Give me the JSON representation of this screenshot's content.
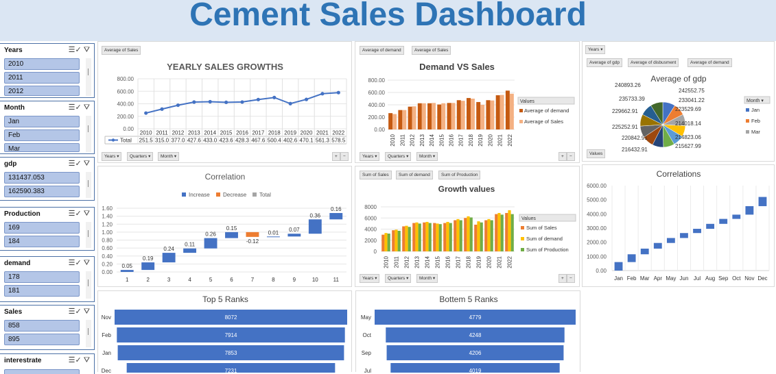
{
  "dashboard_title": "Cement Sales Dashboard",
  "slicers": [
    {
      "title": "Years",
      "items": [
        "2010",
        "2011",
        "2012"
      ]
    },
    {
      "title": "Month",
      "items": [
        "Jan",
        "Feb",
        "Mar"
      ]
    },
    {
      "title": "gdp",
      "items": [
        "131437.053",
        "162590.383"
      ]
    },
    {
      "title": "Production",
      "items": [
        "169",
        "184"
      ]
    },
    {
      "title": "demand",
      "items": [
        "178",
        "181"
      ]
    },
    {
      "title": "Sales",
      "items": [
        "858",
        "895"
      ]
    },
    {
      "title": "interestrate",
      "items": []
    }
  ],
  "yearly": {
    "field_button": "Average of Sales",
    "filter_buttons": [
      "Years ▾",
      "Quarters ▾",
      "Month ▾"
    ],
    "legend_label": "Total",
    "chart_data": {
      "type": "line",
      "title": "YEARLY SALES GROWTHS",
      "categories": [
        "2010",
        "2011",
        "2012",
        "2013",
        "2014",
        "2015",
        "2016",
        "2017",
        "2018",
        "2019",
        "2020",
        "2021",
        "2022"
      ],
      "values": [
        251.5,
        315.0,
        377.0,
        427.6,
        433.0,
        423.6,
        428.3,
        467.6,
        500.4,
        402.6,
        470.1,
        561.3,
        578.5
      ],
      "value_labels": [
        "251.5",
        "315.0",
        "377.0",
        "427.6",
        "433.0",
        "423.6",
        "428.3",
        "467.6",
        "500.4",
        "402.6",
        "470.1",
        "561.3",
        "578.5"
      ],
      "ylim": [
        0,
        800
      ],
      "yticks": [
        "0.00",
        "200.00",
        "400.00",
        "600.00",
        "800.00"
      ]
    }
  },
  "demand_sales": {
    "field_buttons": [
      "Average of demand",
      "Average of Sales"
    ],
    "filter_buttons": [
      "Years ▾",
      "Quarters ▾",
      "Month ▾"
    ],
    "legend_title": "Values",
    "colors": {
      "demand": "#c55a11",
      "sales": "#f4b183"
    },
    "chart_data": {
      "type": "bar",
      "title": "Demand VS Sales",
      "categories": [
        "2010",
        "2011",
        "2012",
        "2013",
        "2014",
        "2015",
        "2016",
        "2017",
        "2018",
        "2019",
        "2020",
        "2021",
        "2022"
      ],
      "series": [
        {
          "name": "Average of demand",
          "values": [
            265,
            315,
            370,
            425,
            425,
            405,
            430,
            475,
            510,
            445,
            475,
            555,
            630
          ]
        },
        {
          "name": "Average of Sales",
          "values": [
            250,
            315,
            375,
            425,
            430,
            425,
            430,
            465,
            500,
            400,
            470,
            560,
            580
          ]
        }
      ],
      "ylim": [
        0,
        800
      ],
      "yticks": [
        "0.00",
        "200.00",
        "400.00",
        "600.00",
        "800.00"
      ]
    }
  },
  "gdp": {
    "field_buttons": [
      "Average of gdp",
      "Average of disbusment",
      "Average of demand"
    ],
    "top_button": "Years ▾",
    "values_button": "Values",
    "legend_title": "Month ▾",
    "legend": [
      "Jan",
      "Feb",
      "Mar"
    ],
    "colors": [
      "#4472c4",
      "#ed7d31",
      "#a5a5a5"
    ],
    "chart_data": {
      "type": "pie",
      "title": "Average of gdp",
      "labels": [
        "242552.75",
        "233041.22",
        "223529.69",
        "214018.14",
        "214823.06",
        "215627.99",
        "216432.91",
        "220842.91",
        "225252.91",
        "229662.91",
        "235733.39",
        "240893.26"
      ],
      "values": [
        242552.75,
        233041.22,
        223529.69,
        214018.14,
        214823.06,
        215627.99,
        216432.91,
        220842.91,
        225252.91,
        229662.91,
        235733.39,
        240893.26
      ]
    }
  },
  "correlation": {
    "colors": {
      "increase": "#4472c4",
      "decrease": "#ed7d31",
      "total": "#a5a5a5"
    },
    "chart_data": {
      "type": "bar",
      "title": "Correlation",
      "legend": [
        "Increase",
        "Decrease",
        "Total"
      ],
      "categories": [
        "1",
        "2",
        "3",
        "4",
        "5",
        "6",
        "7",
        "8",
        "9",
        "10",
        "11"
      ],
      "deltas": [
        0.05,
        0.19,
        0.24,
        0.11,
        0.26,
        0.15,
        -0.12,
        0.01,
        0.07,
        0.36,
        0.16
      ],
      "value_labels": [
        "0.05",
        "0.19",
        "0.24",
        "0.11",
        "0.26",
        "0.15",
        "-0.12",
        "0.01",
        "0.07",
        "0.36",
        "0.16"
      ],
      "ylim": [
        0,
        1.6
      ],
      "yticks": [
        "0.00",
        "0.20",
        "0.40",
        "0.60",
        "0.80",
        "1.00",
        "1.20",
        "1.40",
        "1.60"
      ]
    }
  },
  "growth": {
    "field_buttons": [
      "Sum of Sales",
      "Sum of demand",
      "Sum of Production"
    ],
    "filter_buttons": [
      "Years ▾",
      "Quarters ▾",
      "Month ▾"
    ],
    "legend_title": "Values",
    "colors": {
      "sales": "#ed7d31",
      "demand": "#ffc000",
      "production": "#70ad47"
    },
    "chart_data": {
      "type": "bar",
      "title": "Growth values",
      "categories": [
        "2010",
        "2011",
        "2012",
        "2013",
        "2014",
        "2015",
        "2016",
        "2017",
        "2018",
        "2019",
        "2020",
        "2021",
        "2022"
      ],
      "series": [
        {
          "name": "Sum of Sales",
          "values": [
            3000,
            3800,
            4500,
            5100,
            5200,
            5100,
            5100,
            5600,
            6000,
            4800,
            5600,
            6700,
            6900
          ]
        },
        {
          "name": "Sum of demand",
          "values": [
            3300,
            3900,
            4600,
            5200,
            5300,
            5000,
            5300,
            5800,
            6300,
            5400,
            5800,
            6900,
            7400
          ]
        },
        {
          "name": "Sum of Production",
          "values": [
            3200,
            3700,
            4400,
            5000,
            5100,
            4900,
            5100,
            5600,
            6100,
            5200,
            5600,
            6600,
            6700
          ]
        }
      ],
      "ylim": [
        0,
        8000
      ],
      "yticks": [
        "0",
        "2000",
        "4000",
        "6000",
        "8000"
      ]
    }
  },
  "correlations2": {
    "color": "#4472c4",
    "chart_data": {
      "type": "bar",
      "title": "Correlations",
      "categories": [
        "Jan",
        "Feb",
        "Mar",
        "Apr",
        "May",
        "Jun",
        "Jul",
        "Aug",
        "Sep",
        "Oct",
        "Nov",
        "Dec"
      ],
      "ranges": [
        [
          0,
          600
        ],
        [
          600,
          1150
        ],
        [
          1150,
          1550
        ],
        [
          1550,
          1950
        ],
        [
          1950,
          2300
        ],
        [
          2300,
          2650
        ],
        [
          2650,
          2950
        ],
        [
          2950,
          3300
        ],
        [
          3300,
          3650
        ],
        [
          3650,
          3950
        ],
        [
          3950,
          4550
        ],
        [
          4550,
          5200
        ]
      ],
      "ylim": [
        0,
        6000
      ],
      "yticks": [
        "0.00",
        "1000.00",
        "2000.00",
        "3000.00",
        "4000.00",
        "5000.00",
        "6000.00"
      ]
    }
  },
  "top5": {
    "color": "#4472c4",
    "chart_data": {
      "type": "bar",
      "title": "Top 5 Ranks",
      "categories": [
        "Nov",
        "Feb",
        "Jan",
        "Dec"
      ],
      "values": [
        8072,
        7914,
        7853,
        7231
      ],
      "value_labels": [
        "8072",
        "7914",
        "7853",
        "7231"
      ],
      "xlim": [
        0,
        8072
      ]
    }
  },
  "bottom5": {
    "color": "#4472c4",
    "chart_data": {
      "type": "bar",
      "title": "Bottem 5 Ranks",
      "categories": [
        "May",
        "Oct",
        "Sep",
        "Jul"
      ],
      "values": [
        4779,
        4248,
        4206,
        4019
      ],
      "value_labels": [
        "4779",
        "4248",
        "4206",
        "4019"
      ],
      "xlim": [
        0,
        4779
      ]
    }
  }
}
